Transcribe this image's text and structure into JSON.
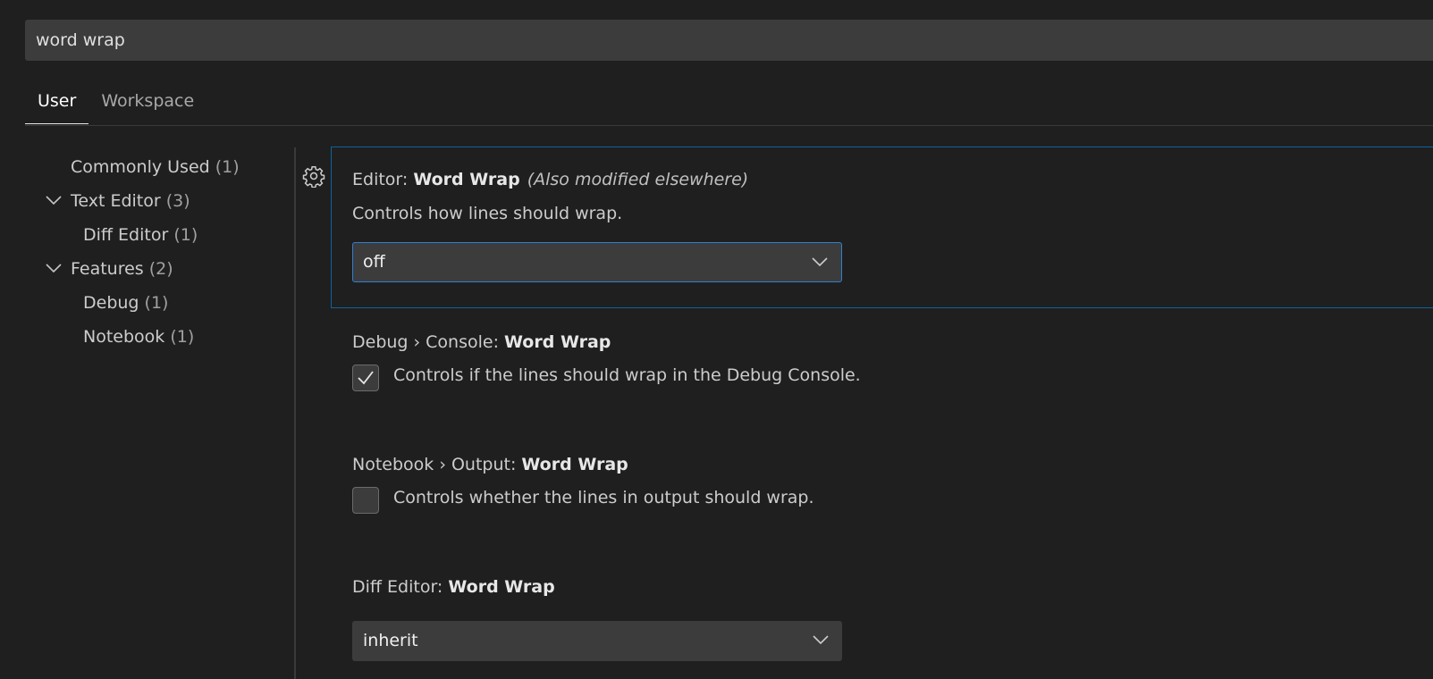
{
  "search": {
    "value": "word wrap",
    "icon": "none"
  },
  "tabs": [
    {
      "label": "User",
      "active": true
    },
    {
      "label": "Workspace",
      "active": false
    }
  ],
  "toc": {
    "items": [
      {
        "label": "Commonly Used",
        "count": "(1)",
        "expandable": false
      },
      {
        "label": "Text Editor",
        "count": "(3)",
        "expandable": true,
        "icon": "chevron-down-icon"
      },
      {
        "label": "Diff Editor",
        "count": "(1)",
        "expandable": false
      },
      {
        "label": "Features",
        "count": "(2)",
        "expandable": true,
        "icon": "chevron-down-icon"
      },
      {
        "label": "Debug",
        "count": "(1)",
        "expandable": false
      },
      {
        "label": "Notebook",
        "count": "(1)",
        "expandable": false
      }
    ]
  },
  "settings": {
    "editor_word_wrap": {
      "prefix": "Editor: ",
      "key": "Word Wrap",
      "modified_note": "(Also modified elsewhere)",
      "description": "Controls how lines should wrap.",
      "value": "off",
      "gear_icon": "gear-icon"
    },
    "debug_console_word_wrap": {
      "prefix": "Debug › Console: ",
      "key": "Word Wrap",
      "description": "Controls if the lines should wrap in the Debug Console.",
      "checked": true
    },
    "notebook_output_word_wrap": {
      "prefix": "Notebook › Output: ",
      "key": "Word Wrap",
      "description": "Controls whether the lines in output should wrap.",
      "checked": false
    },
    "diff_editor_word_wrap": {
      "prefix": "Diff Editor: ",
      "key": "Word Wrap",
      "value": "inherit"
    }
  },
  "colors": {
    "background": "#1f1f1f",
    "input_background": "#3c3c3c",
    "focus_border": "#0e639c",
    "select_focus_border": "#2f7fd1"
  }
}
